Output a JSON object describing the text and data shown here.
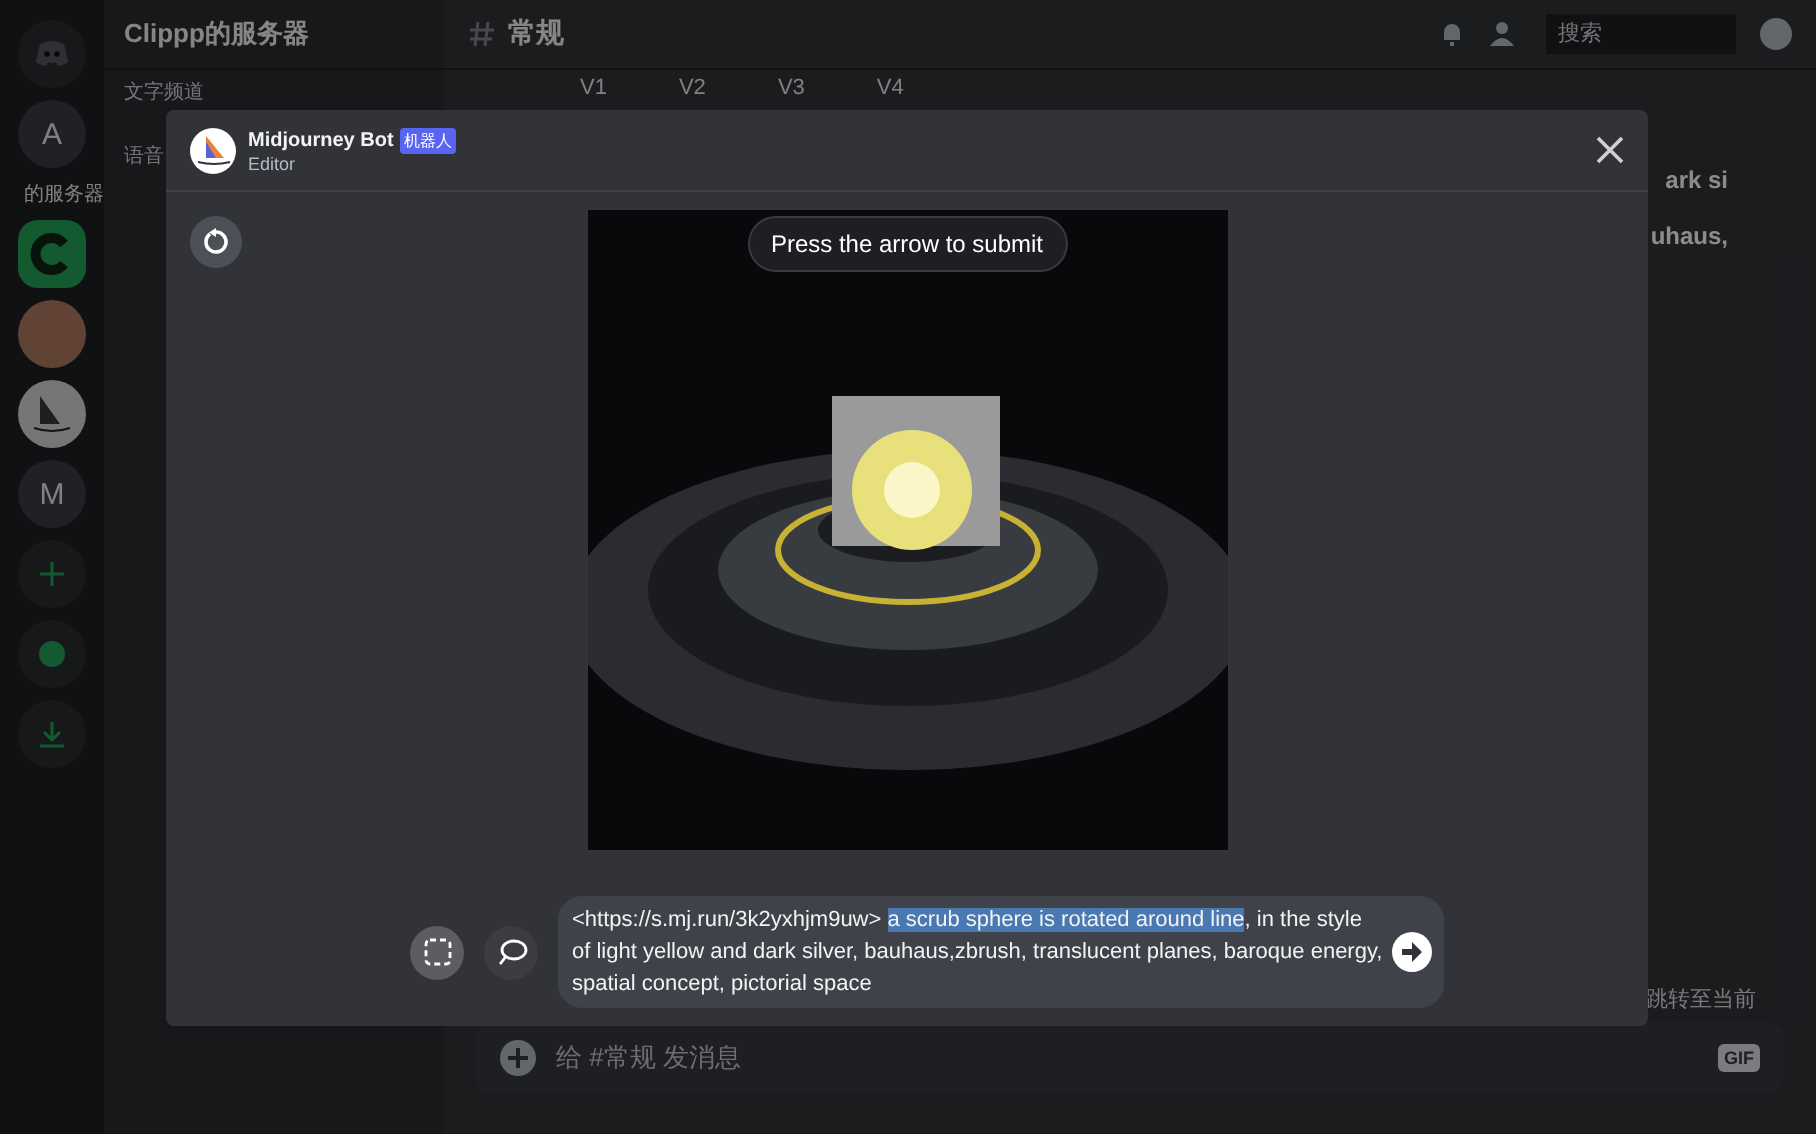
{
  "server_rail": {
    "items": [
      {
        "kind": "logo"
      },
      {
        "kind": "letter",
        "label": "A"
      },
      {
        "kind": "text",
        "label": "的服务器"
      },
      {
        "kind": "app"
      },
      {
        "kind": "photo"
      },
      {
        "kind": "boat"
      },
      {
        "kind": "letter",
        "label": "M"
      },
      {
        "kind": "add"
      },
      {
        "kind": "explore"
      },
      {
        "kind": "download"
      }
    ]
  },
  "channel_sidebar": {
    "server_name": "Clippp的服务器",
    "categories": [
      "文字频道",
      "语音"
    ]
  },
  "header": {
    "channel": "常规",
    "search": {
      "placeholder": "搜索"
    }
  },
  "version_tabs": [
    "V1",
    "V2",
    "V3",
    "V4"
  ],
  "background_messages": [
    "ark si",
    "uhaus,"
  ],
  "jump_bar": {
    "label": "跳转至当前"
  },
  "composer": {
    "placeholder": "给 #常规 发消息",
    "gif": "GIF"
  },
  "modal": {
    "title": "Midjourney Bot",
    "badge": "机器人",
    "subtitle": "Editor",
    "hint": "Press the arrow to submit",
    "prompt": {
      "before": "<https://s.mj.run/3k2yxhjm9uw> ",
      "selected": "a scrub sphere is rotated around line",
      "after": ", in the style of light yellow and dark silver, bauhaus,zbrush, translucent planes, baroque energy, spatial concept, pictorial space"
    },
    "tools": [
      {
        "kind": "rect",
        "selected": true
      },
      {
        "kind": "lasso",
        "selected": false
      }
    ]
  }
}
